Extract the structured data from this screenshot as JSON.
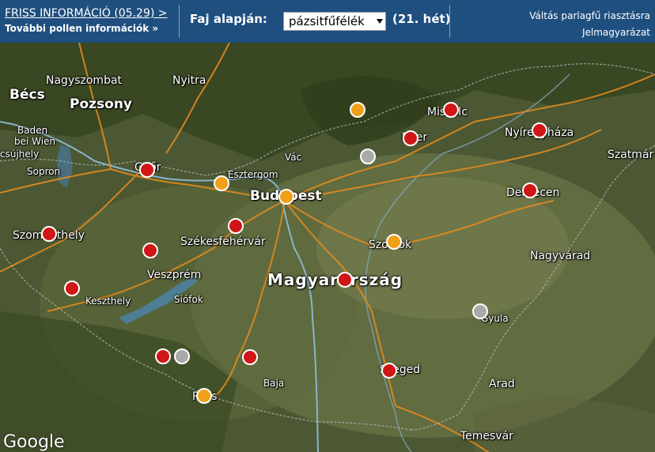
{
  "topbar": {
    "fresh_info": "FRISS INFORMÁCIÓ (05.29) >",
    "more_pollen": "További pollen információk »",
    "species_label": "Faj alapján:",
    "species_selected": "pázsitfűfélék",
    "week": "(21. hét)",
    "switch_ragweed": "Váltás parlagfű riasztásra",
    "legend_link": "Jelmagyarázat"
  },
  "status_colors": {
    "red": "#d01616",
    "orange": "#f0a018",
    "gray": "#a9a9a9"
  },
  "map": {
    "country_label": "Magyarország",
    "google_logo": "Google",
    "cities": [
      {
        "key": "becs",
        "name": "Bécs",
        "cls": "cap"
      },
      {
        "key": "pozsony",
        "name": "Pozsony",
        "cls": "cap"
      },
      {
        "key": "nagyszombat",
        "name": "Nagyszombat",
        "cls": ""
      },
      {
        "key": "nyitra",
        "name": "Nyitra",
        "cls": ""
      },
      {
        "key": "baden",
        "name": "Baden",
        "cls": "sm"
      },
      {
        "key": "beiwien",
        "name": "bei Wien",
        "cls": "sm"
      },
      {
        "key": "csuhely",
        "name": "csújhely",
        "cls": "sm"
      },
      {
        "key": "sopron",
        "name": "Sopron",
        "cls": "sm"
      },
      {
        "key": "gyor",
        "name": "Győr",
        "cls": ""
      },
      {
        "key": "esztergom",
        "name": "Esztergom",
        "cls": "sm"
      },
      {
        "key": "vac",
        "name": "Vác",
        "cls": "sm"
      },
      {
        "key": "budapest",
        "name": "Budapest",
        "cls": "cap"
      },
      {
        "key": "szombathely",
        "name": "Szombathely",
        "cls": ""
      },
      {
        "key": "szekesfehervar",
        "name": "Székesfehérvár",
        "cls": ""
      },
      {
        "key": "veszprem",
        "name": "Veszprém",
        "cls": ""
      },
      {
        "key": "keszthely",
        "name": "Keszthely",
        "cls": "sm"
      },
      {
        "key": "siofok",
        "name": "Siófok",
        "cls": "sm"
      },
      {
        "key": "miskolc",
        "name": "Miskolc",
        "cls": ""
      },
      {
        "key": "eger",
        "name": "Eger",
        "cls": ""
      },
      {
        "key": "nyiregyhaza",
        "name": "Nyíregyháza",
        "cls": ""
      },
      {
        "key": "szatmar",
        "name": "Szatmár",
        "cls": ""
      },
      {
        "key": "debrecen",
        "name": "Debrecen",
        "cls": ""
      },
      {
        "key": "szolnok",
        "name": "Szolnok",
        "cls": ""
      },
      {
        "key": "nagyvarad",
        "name": "Nagyvárad",
        "cls": ""
      },
      {
        "key": "gyula",
        "name": "Gyula",
        "cls": "sm"
      },
      {
        "key": "szeged",
        "name": "Szeged",
        "cls": ""
      },
      {
        "key": "baja",
        "name": "Baja",
        "cls": "sm"
      },
      {
        "key": "pecs",
        "name": "Pécs",
        "cls": ""
      },
      {
        "key": "arad",
        "name": "Arad",
        "cls": ""
      },
      {
        "key": "temesvar",
        "name": "Temesvár",
        "cls": ""
      }
    ],
    "stations": [
      {
        "key": "gyongyos",
        "status": "orange"
      },
      {
        "key": "miskolc",
        "status": "red"
      },
      {
        "key": "nyiregyhaza",
        "status": "red"
      },
      {
        "key": "eger",
        "status": "red"
      },
      {
        "key": "salgotarjan",
        "status": "gray"
      },
      {
        "key": "gyor",
        "status": "red"
      },
      {
        "key": "tatabanya",
        "status": "orange"
      },
      {
        "key": "budapest",
        "status": "orange"
      },
      {
        "key": "debrecen",
        "status": "red"
      },
      {
        "key": "szombathely",
        "status": "red"
      },
      {
        "key": "szekesfehervar",
        "status": "red"
      },
      {
        "key": "szolnok",
        "status": "orange"
      },
      {
        "key": "veszprem",
        "status": "red"
      },
      {
        "key": "zalaegerszeg",
        "status": "red"
      },
      {
        "key": "kecskemet",
        "status": "red"
      },
      {
        "key": "bekescsaba",
        "status": "gray"
      },
      {
        "key": "kaposvar",
        "status": "red"
      },
      {
        "key": "kaposvar2",
        "status": "gray"
      },
      {
        "key": "szekszard",
        "status": "red"
      },
      {
        "key": "szeged",
        "status": "red"
      },
      {
        "key": "pecs",
        "status": "orange"
      }
    ]
  }
}
